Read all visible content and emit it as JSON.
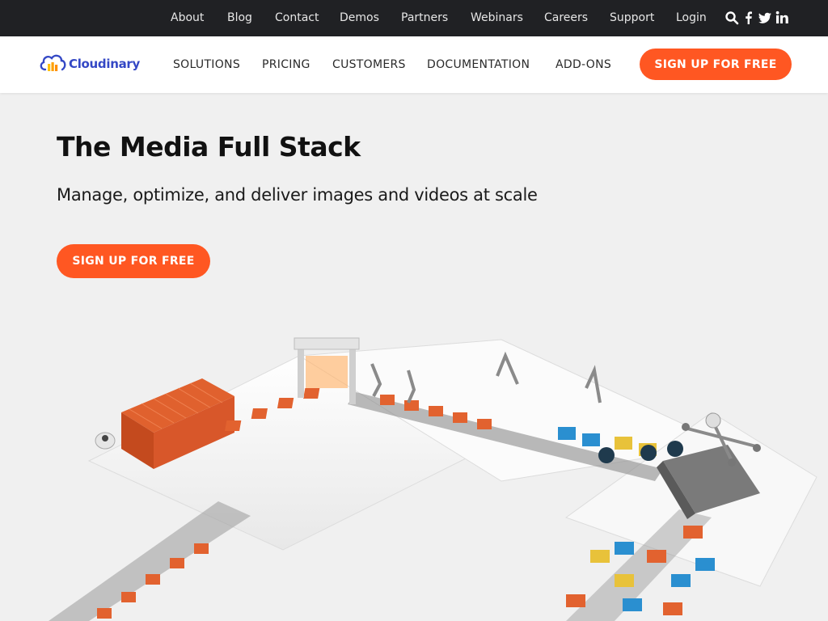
{
  "topbar": {
    "links": [
      "About",
      "Blog",
      "Contact",
      "Demos",
      "Partners",
      "Webinars",
      "Careers",
      "Support",
      "Login"
    ],
    "icons": [
      "search-icon",
      "facebook-icon",
      "twitter-icon",
      "linkedin-icon"
    ]
  },
  "nav": {
    "logo_text": "Cloudinary",
    "items": [
      "SOLUTIONS",
      "PRICING",
      "CUSTOMERS",
      "DOCUMENTATION",
      "ADD-ONS"
    ],
    "cta": "SIGN UP FOR FREE"
  },
  "hero": {
    "title": "The Media Full Stack",
    "subtitle": "Manage, optimize, and deliver images and videos at scale",
    "cta": "SIGN UP FOR FREE"
  },
  "colors": {
    "accent": "#ff5722",
    "topbar_bg": "#202124",
    "brand_blue": "#3448c5",
    "page_bg": "#f0f0f0"
  }
}
